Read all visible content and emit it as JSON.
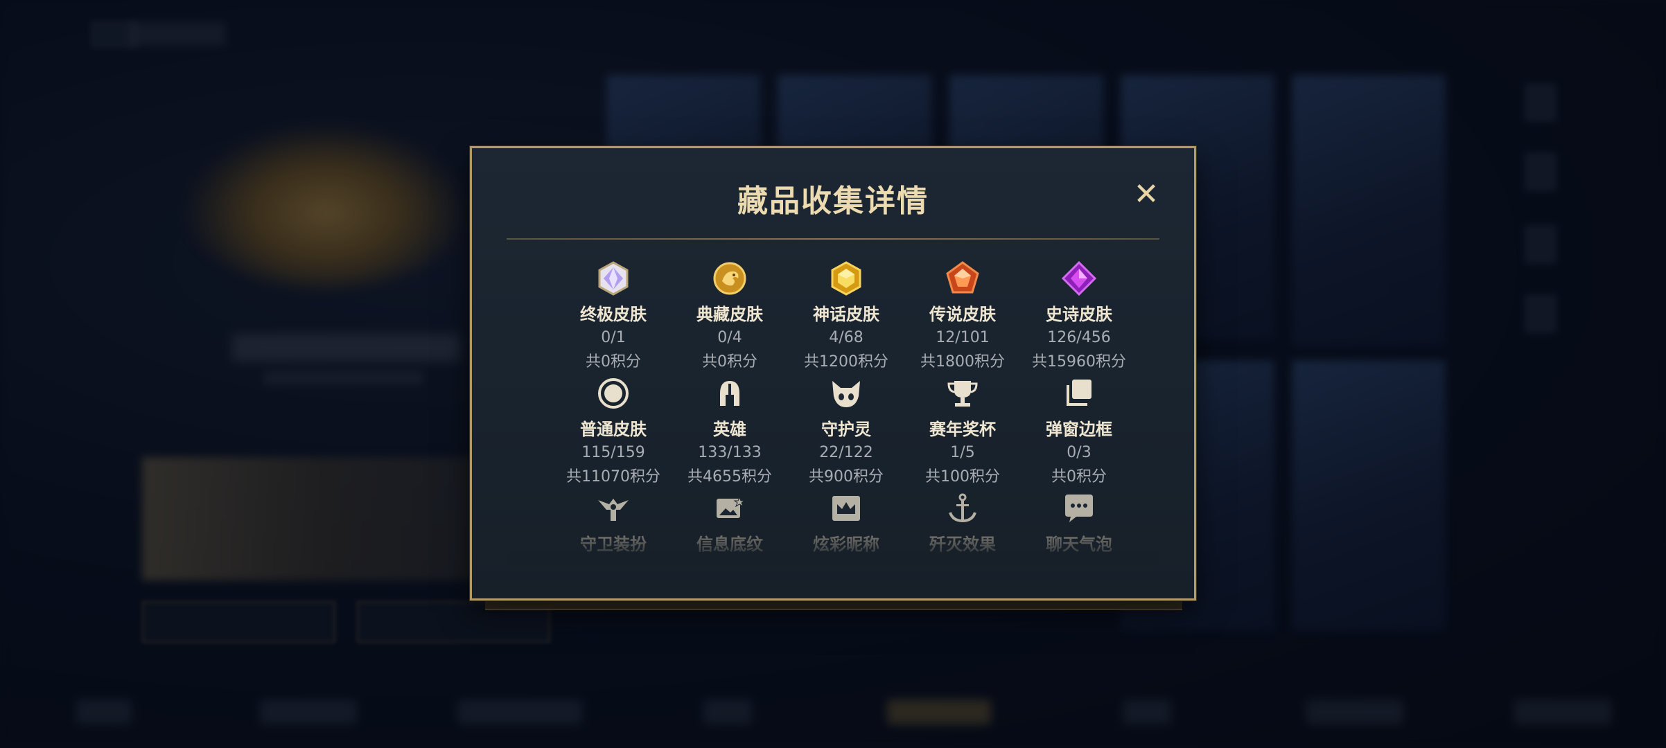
{
  "modal": {
    "title": "藏品收集详情",
    "close_label": "✕"
  },
  "categories": [
    {
      "name": "终极皮肤",
      "count": "0/1",
      "points": "共0积分",
      "icon": "diamond-white-icon"
    },
    {
      "name": "典藏皮肤",
      "count": "0/4",
      "points": "共0积分",
      "icon": "gold-dragon-icon"
    },
    {
      "name": "神话皮肤",
      "count": "4/68",
      "points": "共1200积分",
      "icon": "gold-gem-icon"
    },
    {
      "name": "传说皮肤",
      "count": "12/101",
      "points": "共1800积分",
      "icon": "orange-gem-icon"
    },
    {
      "name": "史诗皮肤",
      "count": "126/456",
      "points": "共15960积分",
      "icon": "purple-gem-icon"
    },
    {
      "name": "普通皮肤",
      "count": "115/159",
      "points": "共11070积分",
      "icon": "circle-icon"
    },
    {
      "name": "英雄",
      "count": "133/133",
      "points": "共4655积分",
      "icon": "helmet-icon"
    },
    {
      "name": "守护灵",
      "count": "22/122",
      "points": "共900积分",
      "icon": "pet-icon"
    },
    {
      "name": "赛年奖杯",
      "count": "1/5",
      "points": "共100积分",
      "icon": "trophy-icon"
    },
    {
      "name": "弹窗边框",
      "count": "0/3",
      "points": "共0积分",
      "icon": "frame-icon"
    },
    {
      "name": "守卫装扮",
      "icon": "ward-icon"
    },
    {
      "name": "信息底纹",
      "icon": "image-card-icon"
    },
    {
      "name": "炫彩昵称",
      "icon": "crown-card-icon"
    },
    {
      "name": "歼灭效果",
      "icon": "anchor-icon"
    },
    {
      "name": "聊天气泡",
      "icon": "chat-bubble-icon"
    }
  ],
  "colors": {
    "gold": "#b39a66",
    "title": "#ecdab0",
    "panel": "#1c2733"
  }
}
